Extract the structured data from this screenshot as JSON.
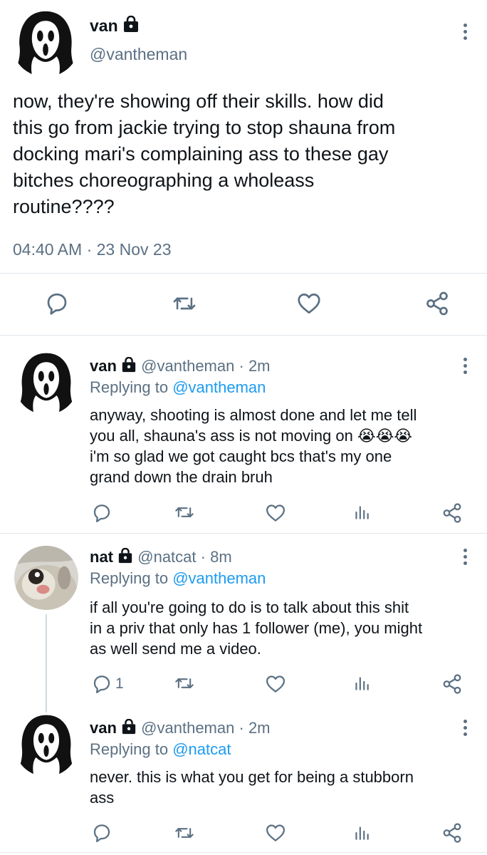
{
  "main_tweet": {
    "name": "van",
    "handle": "@vantheman",
    "text_lines": [
      "now, they're showing off their skills. how did",
      "this go from jackie trying to stop shauna from",
      "docking mari's complaining ass to these gay",
      "bitches choreographing a wholeass",
      "routine????"
    ],
    "time": "04:40 AM",
    "separator": "·",
    "date": "23 Nov 23"
  },
  "replies": [
    {
      "name": "van",
      "handle": "@vantheman",
      "age": "2m",
      "replying_label": "Replying to",
      "replying_to": "@vantheman",
      "text_lines": [
        "anyway, shooting is almost done and let me tell",
        "you all, shauna's ass is not moving on",
        "i'm so glad we got caught bcs that's my one",
        "grand down the drain bruh"
      ],
      "emoji": "😭😭😭"
    },
    {
      "name": "nat",
      "handle": "@natcat",
      "age": "8m",
      "replying_label": "Replying to",
      "replying_to": "@vantheman",
      "text_lines": [
        "if all you're going to do is to talk about this shit",
        "in a priv that only has 1 follower (me), you might",
        "as well send me a video."
      ],
      "reply_count": "1"
    },
    {
      "name": "van",
      "handle": "@vantheman",
      "age": "2m",
      "replying_label": "Replying to",
      "replying_to": "@natcat",
      "text_lines": [
        "never. this is what you get for being a stubborn",
        "ass"
      ]
    }
  ],
  "icons": {
    "lock": "lock-icon",
    "menu": "more-vertical-icon",
    "reply": "reply-icon",
    "retweet": "retweet-icon",
    "like": "heart-icon",
    "share": "share-icon",
    "analytics": "analytics-icon"
  },
  "colors": {
    "text": "#0f1419",
    "secondary": "#5b7083",
    "link": "#1d9bf0",
    "divider": "#e1e8ed"
  }
}
